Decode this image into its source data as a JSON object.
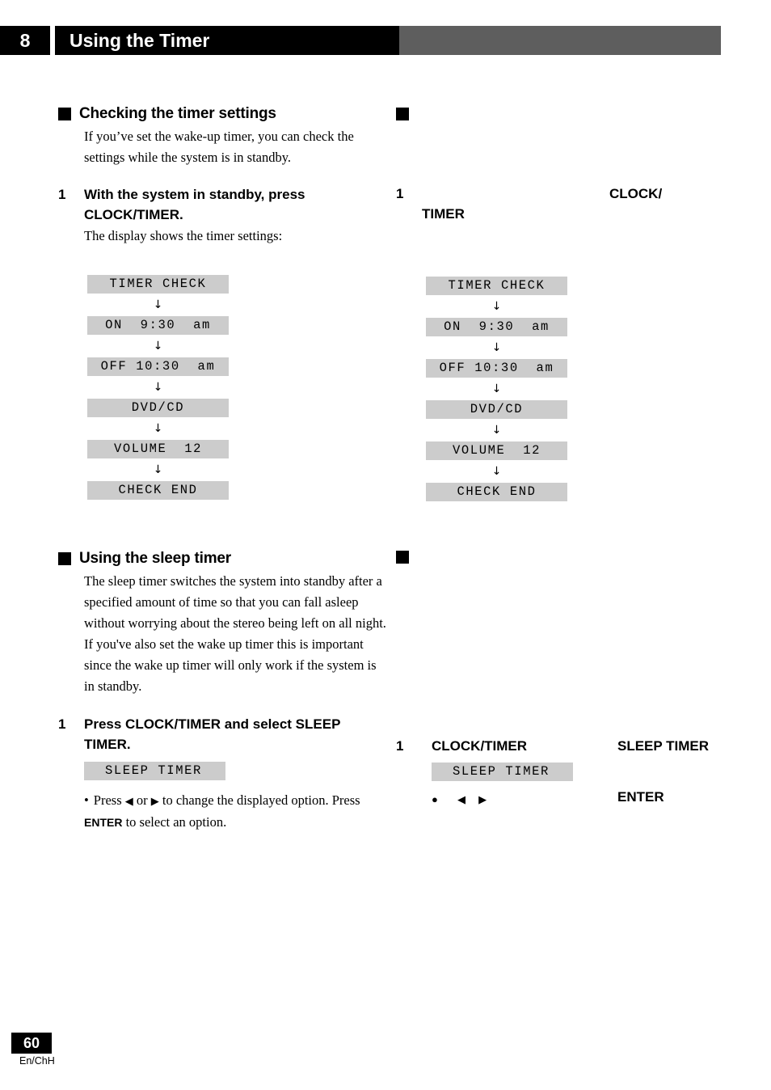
{
  "header": {
    "chapter_number": "8",
    "chapter_title": "Using the Timer",
    "gray_bar_color": "#5e5e5e"
  },
  "footer": {
    "page_number": "60",
    "language_code": "En/ChH"
  },
  "colors": {
    "lcd_background": "#cccccc",
    "header_black": "#000000",
    "header_gray": "#5e5e5e"
  },
  "left_column": {
    "section1": {
      "title": "Checking the timer settings",
      "intro": "If you’ve set the wake-up timer, you can check the settings while the system is in standby.",
      "step1": {
        "number": "1",
        "heading": "With the system in standby, press CLOCK/TIMER.",
        "subtext": "The display shows the timer settings:"
      },
      "lcd_sequence": [
        "TIMER CHECK",
        "ON  9:30  am",
        "OFF 10:30  am",
        "DVD/CD",
        "VOLUME  12",
        "CHECK END"
      ],
      "arrow_glyph": "↓"
    },
    "section2": {
      "title": "Using the sleep timer",
      "intro": "The sleep timer switches the system into standby after a specified amount of time so that you can fall asleep without worrying about the stereo being left on all night. If you've also set the wake up timer this is important since the wake up timer will only work if the system is in standby.",
      "step1": {
        "number": "1",
        "heading": "Press CLOCK/TIMER and select SLEEP TIMER.",
        "lcd": "SLEEP TIMER",
        "bullet_dot": "•",
        "bullet_part1": "Press",
        "arrow_left": "◀",
        "bullet_or": "or",
        "arrow_right": "▶",
        "bullet_part2": "to change the displayed option. Press",
        "bullet_keyword": "ENTER",
        "bullet_part3": "to select an option."
      }
    }
  },
  "right_column": {
    "section1": {
      "marker": true,
      "step1": {
        "number": "1",
        "keyword_a": "CLOCK/",
        "keyword_b": "TIMER"
      },
      "lcd_sequence": [
        "TIMER CHECK",
        "ON  9:30  am",
        "OFF 10:30  am",
        "DVD/CD",
        "VOLUME  12",
        "CHECK END"
      ],
      "arrow_glyph": "↓"
    },
    "section2": {
      "marker": true,
      "step1": {
        "number": "1",
        "keyword_a": "CLOCK/TIMER",
        "keyword_b": "SLEEP TIMER",
        "lcd": "SLEEP TIMER",
        "bullet_dot": "●",
        "arrow_left": "◀",
        "arrow_right": "▶",
        "keyword_enter": "ENTER"
      }
    }
  }
}
